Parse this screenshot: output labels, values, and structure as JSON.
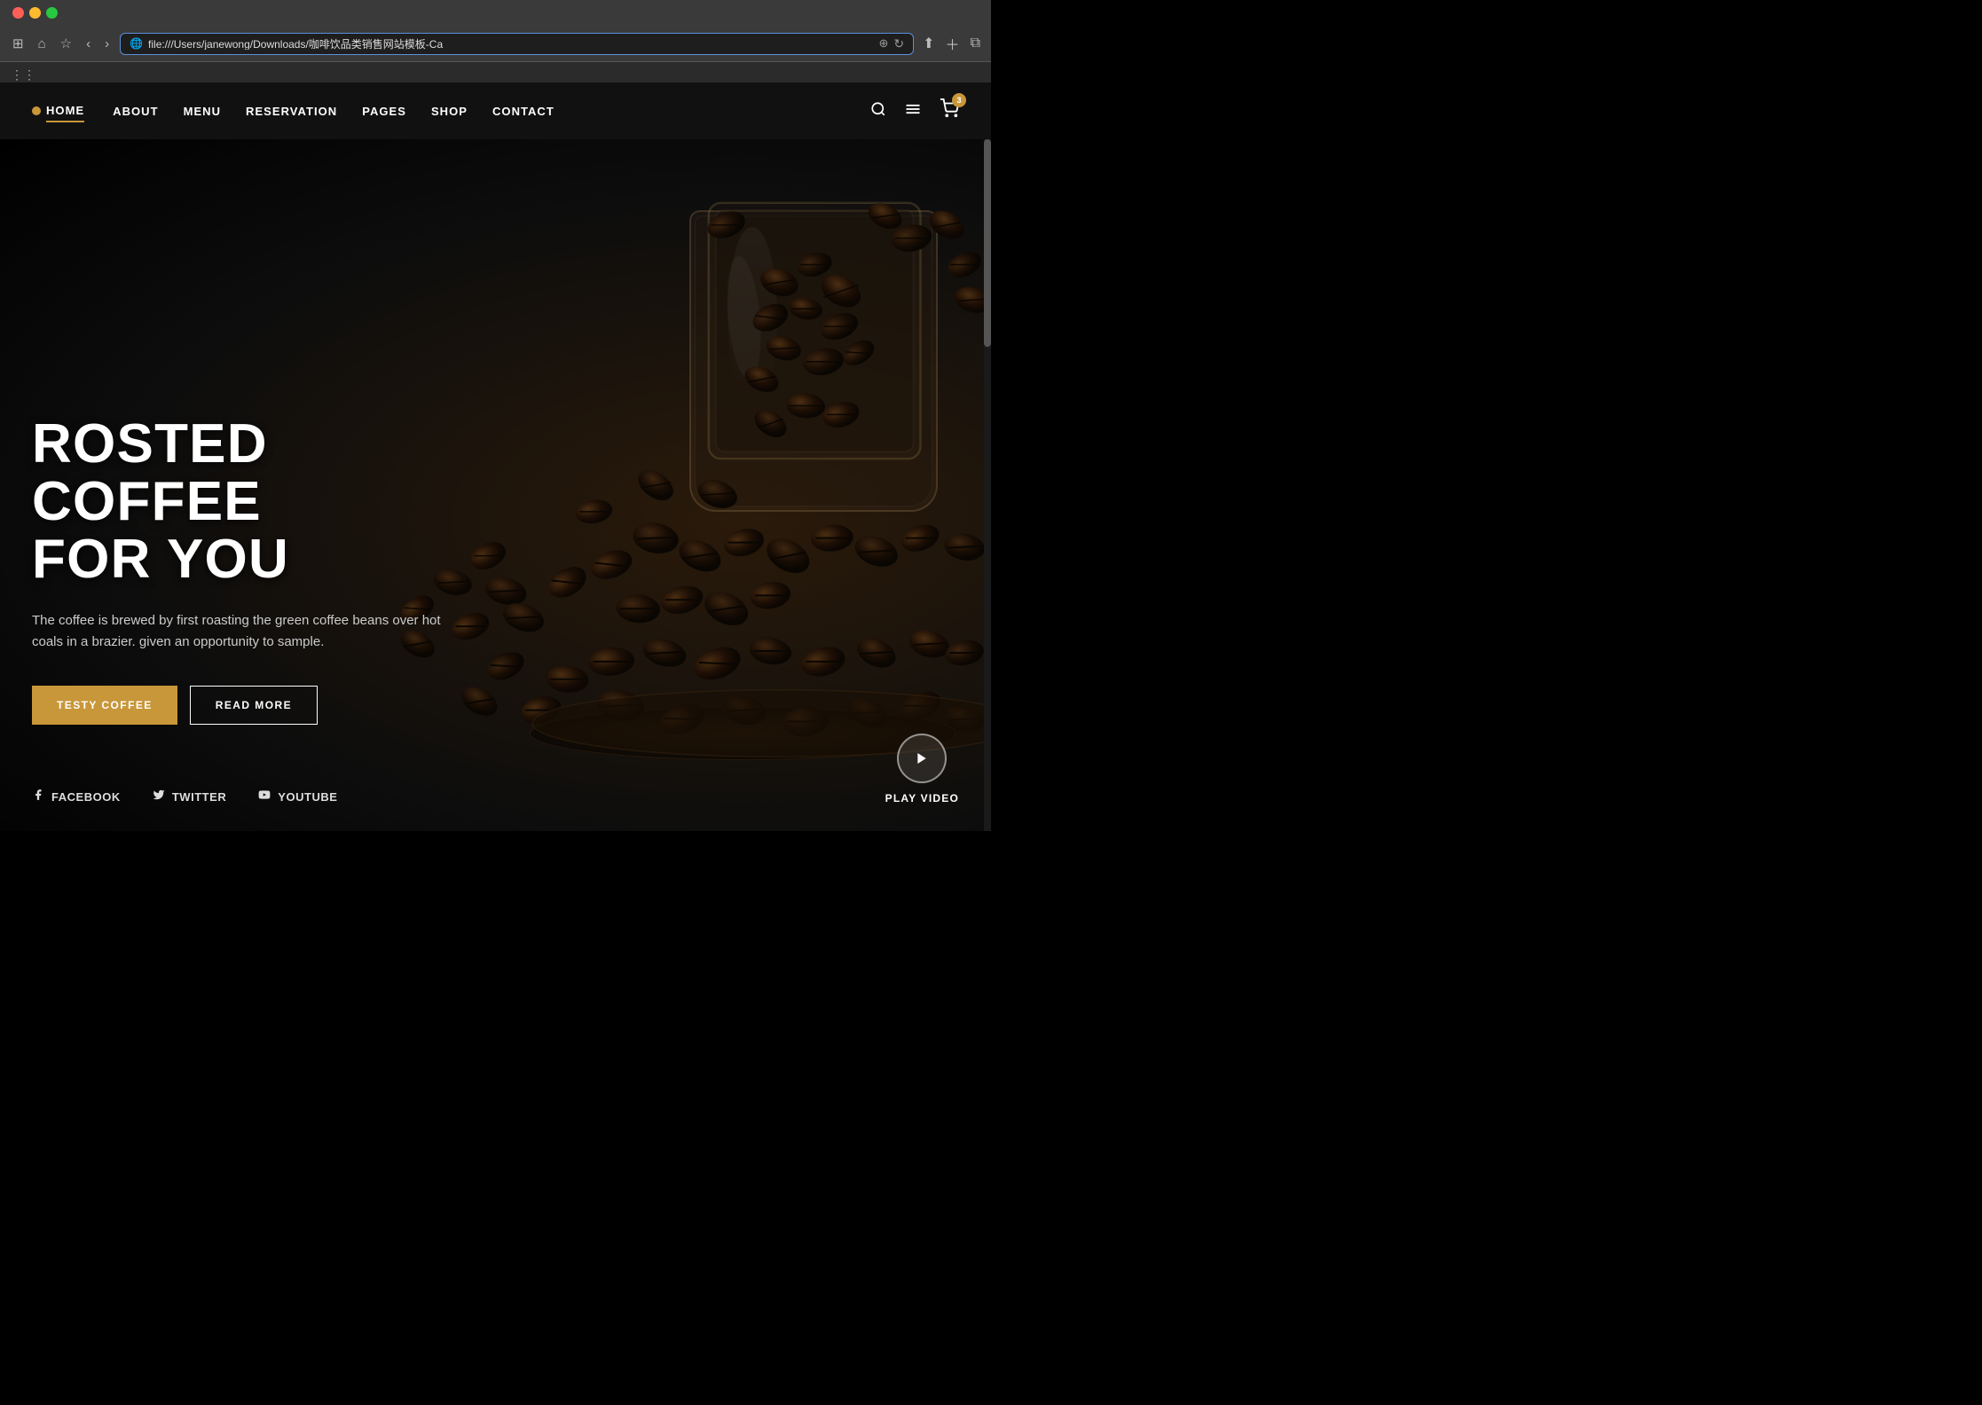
{
  "browser": {
    "url": "file:///Users/janewong/Downloads/咖啡饮品类销售网站模板-Ca",
    "tab_title": "咖啡饮品类销售网站模板-Ca"
  },
  "nav": {
    "logo_text": "HOME",
    "links": [
      {
        "id": "home",
        "label": "HOME",
        "active": true
      },
      {
        "id": "about",
        "label": "ABOUT",
        "active": false
      },
      {
        "id": "menu",
        "label": "MENU",
        "active": false
      },
      {
        "id": "reservation",
        "label": "RESERVATION",
        "active": false
      },
      {
        "id": "pages",
        "label": "PAGES",
        "active": false
      },
      {
        "id": "shop",
        "label": "SHOP",
        "active": false
      },
      {
        "id": "contact",
        "label": "CONTACT",
        "active": false
      }
    ],
    "cart_count": "3"
  },
  "hero": {
    "title_line1": "ROSTED COFFEE",
    "title_line2": "FOR YOU",
    "description": "The coffee is brewed by first roasting the green coffee beans over hot coals in a brazier. given an opportunity to sample.",
    "btn_primary": "TESTY COFFEE",
    "btn_secondary": "READ MORE",
    "social_links": [
      {
        "id": "facebook",
        "label": "FACEBOOK",
        "icon": "f"
      },
      {
        "id": "twitter",
        "label": "TWITTER",
        "icon": "t"
      },
      {
        "id": "youtube",
        "label": "YOUTUBE",
        "icon": "y"
      }
    ],
    "play_label": "PLAY VIDEO"
  }
}
